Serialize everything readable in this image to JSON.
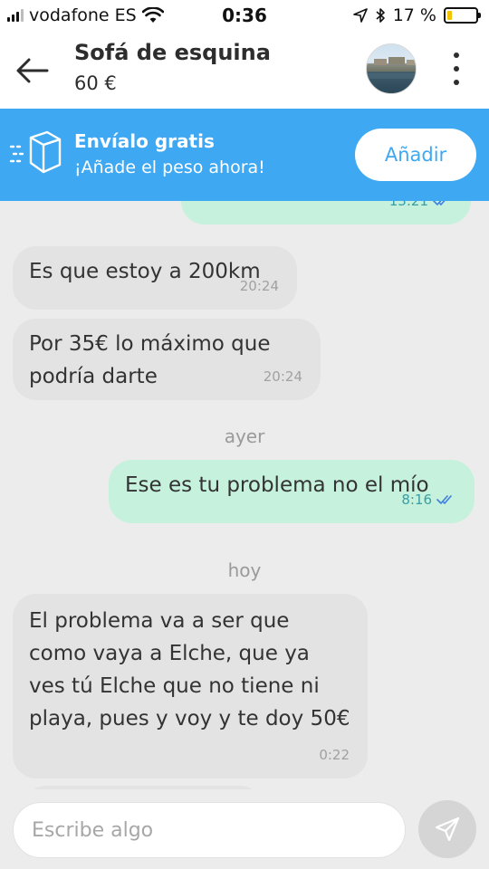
{
  "status_bar": {
    "carrier": "vodafone ES",
    "time": "0:36",
    "battery_text": "17 %",
    "battery_level": 0.17
  },
  "header": {
    "title": "Sofá de esquina",
    "price": "60 €"
  },
  "banner": {
    "title": "Envíalo gratis",
    "subtitle": "¡Añade el peso ahora!",
    "button_label": "Añadir",
    "color": "#3ea8f2"
  },
  "chat": {
    "messages": [
      {
        "direction": "out",
        "text": "",
        "time": "13:21",
        "read": true
      },
      {
        "direction": "in",
        "text": "Es que estoy a 200km",
        "time": "20:24"
      },
      {
        "direction": "in",
        "text": "Por 35€ lo máximo que podría darte",
        "time": "20:24"
      },
      {
        "direction": "out",
        "text": "Ese es tu problema no el mío",
        "time": "8:16",
        "read": true
      },
      {
        "direction": "in",
        "text": "El problema va a ser que como vaya a Elche, que ya ves tú Elche que no tiene ni playa, pues y voy y te doy 50€",
        "time": "0:22"
      }
    ],
    "day_labels": [
      "ayer",
      "hoy"
    ]
  },
  "composer": {
    "placeholder": "Escribe algo"
  },
  "colors": {
    "incoming_bubble": "#e3e3e3",
    "outgoing_bubble": "#c5f1dd",
    "chat_background": "#ececec"
  }
}
